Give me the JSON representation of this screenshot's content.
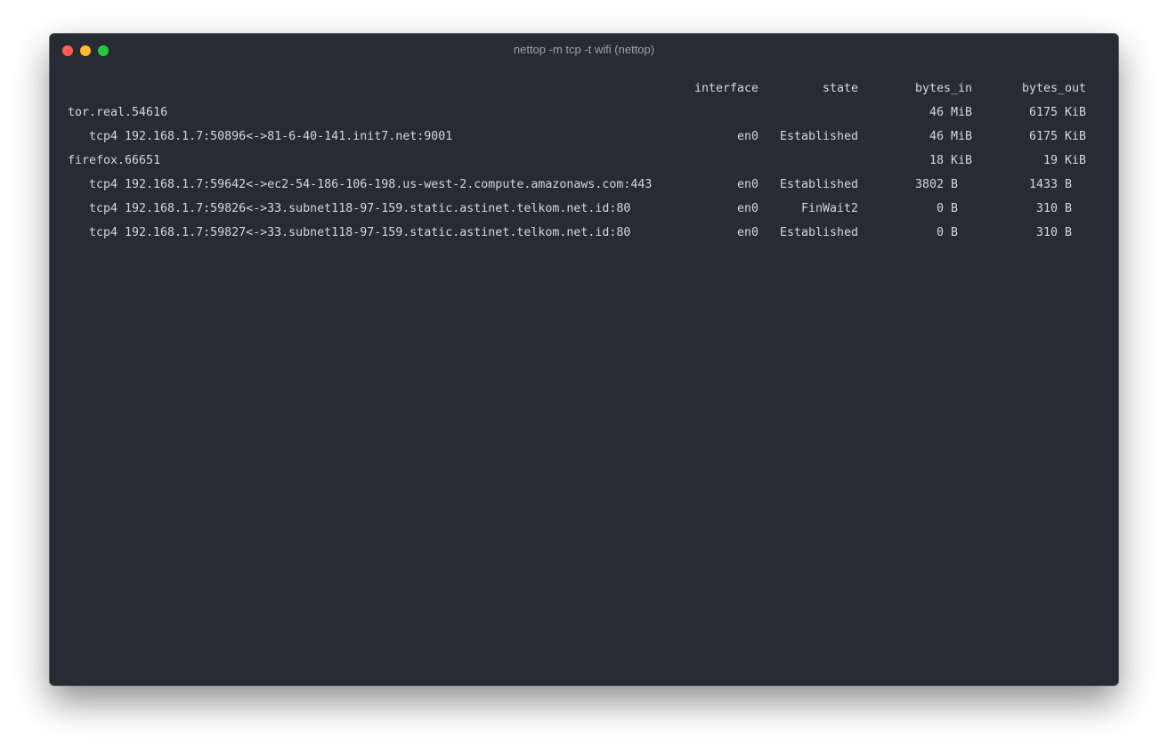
{
  "window": {
    "title": "nettop -m tcp -t wifi (nettop)"
  },
  "header": {
    "interface": "interface",
    "state": "state",
    "bytes_in": "bytes_in",
    "bytes_out": "bytes_out"
  },
  "rows": [
    {
      "name": "tor.real.54616",
      "interface": "",
      "state": "",
      "bytes_in": "46 MiB",
      "bytes_out": "6175 KiB"
    },
    {
      "name": "tcp4 192.168.1.7:50896<->81-6-40-141.init7.net:9001",
      "interface": "en0",
      "state": "Established",
      "bytes_in": "46 MiB",
      "bytes_out": "6175 KiB"
    },
    {
      "name": "firefox.66651",
      "interface": "",
      "state": "",
      "bytes_in": "18 KiB",
      "bytes_out": "19 KiB"
    },
    {
      "name": "tcp4 192.168.1.7:59642<->ec2-54-186-106-198.us-west-2.compute.amazonaws.com:443",
      "interface": "en0",
      "state": "Established",
      "bytes_in": "3802 B  ",
      "bytes_out": "1433 B  "
    },
    {
      "name": "tcp4 192.168.1.7:59826<->33.subnet118-97-159.static.astinet.telkom.net.id:80",
      "interface": "en0",
      "state": "FinWait2",
      "bytes_in": "0 B  ",
      "bytes_out": "310 B  "
    },
    {
      "name": "tcp4 192.168.1.7:59827<->33.subnet118-97-159.static.astinet.telkom.net.id:80",
      "interface": "en0",
      "state": "Established",
      "bytes_in": "0 B  ",
      "bytes_out": "310 B  "
    }
  ]
}
